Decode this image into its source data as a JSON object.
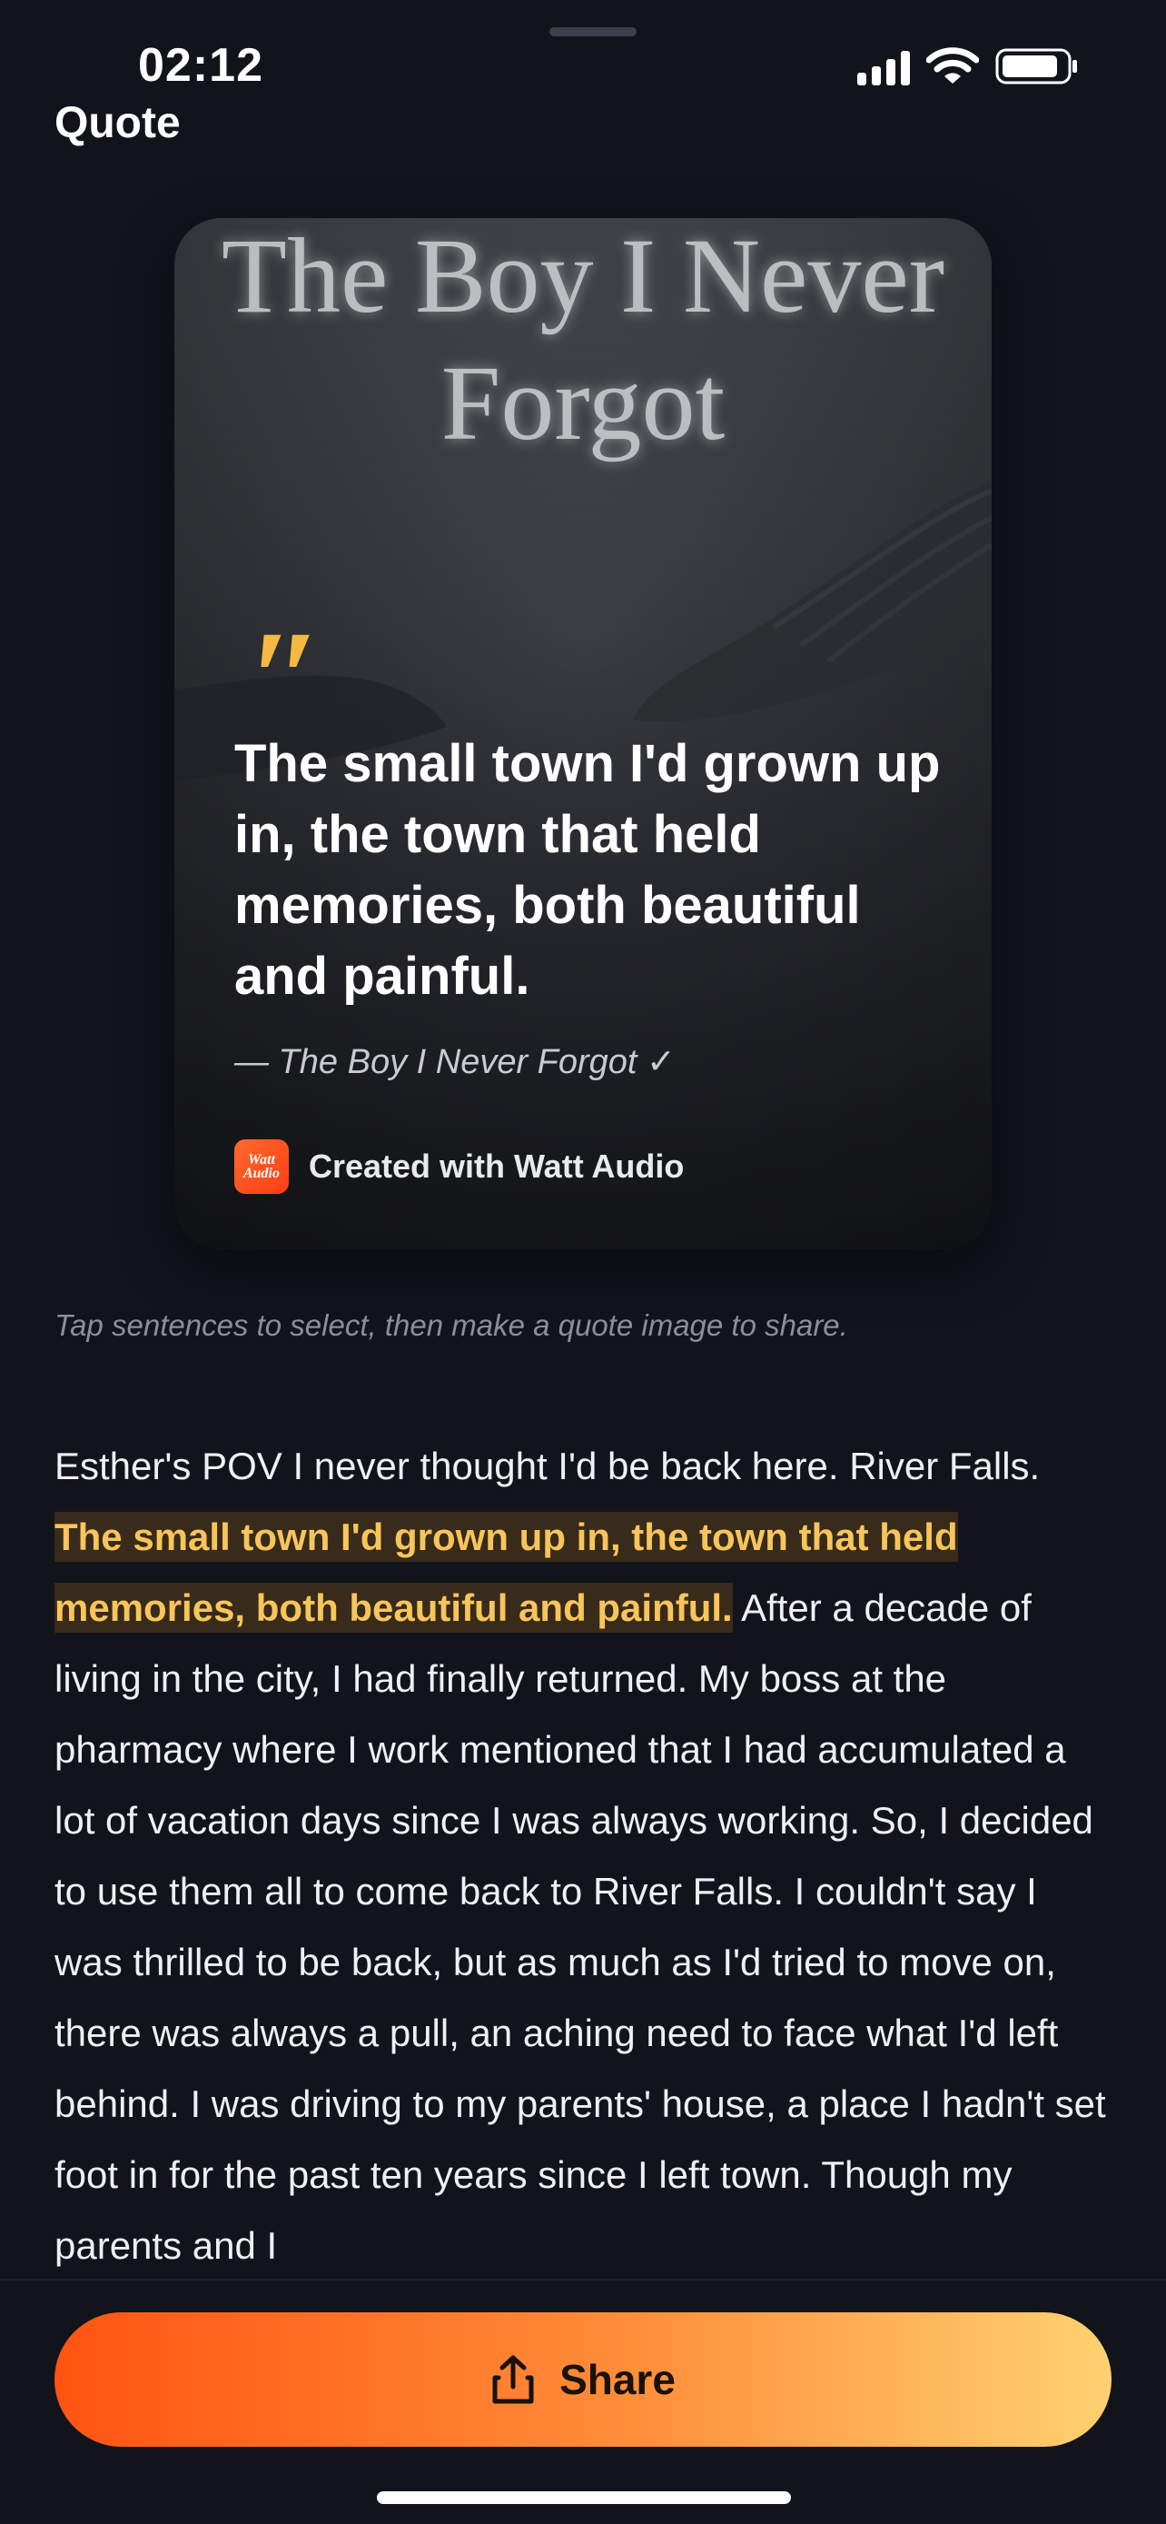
{
  "status_bar": {
    "time": "02:12"
  },
  "header": {
    "title": "Quote"
  },
  "quote_card": {
    "background_title": "The Boy I Never\nForgot",
    "quote_mark": "\"",
    "quote_text": "The small town I'd grown up in, the town that held memories, both beautiful and painful.",
    "attribution": "— The Boy I Never Forgot ✓",
    "brand_logo_line1": "Watt",
    "brand_logo_line2": "Audio",
    "brand_text": "Created with Watt Audio",
    "accent_color": "#f4b942"
  },
  "hint": "Tap sentences to select, then make a quote image to share.",
  "story": {
    "before": "Esther's POV I never thought I'd be back here. River Falls. ",
    "highlighted": "The small town I'd grown up in, the town that held memories, both beautiful and painful.",
    "after": " After a decade of living in the city, I had finally returned. My boss at the pharmacy where I work mentioned that I had accumulated a lot of vacation days since I was always working. So, I decided to use them all to come back to River Falls. I couldn't say I was thrilled to be back, but as much as I'd tried to move on, there was always a pull, an aching need to face what I'd left behind. I was driving to my parents' house, a place I hadn't set foot in for the past ten years since I left town. Though my parents and I",
    "highlight_color": "#f8c55a"
  },
  "share_button": {
    "label": "Share",
    "icon": "share-icon"
  }
}
